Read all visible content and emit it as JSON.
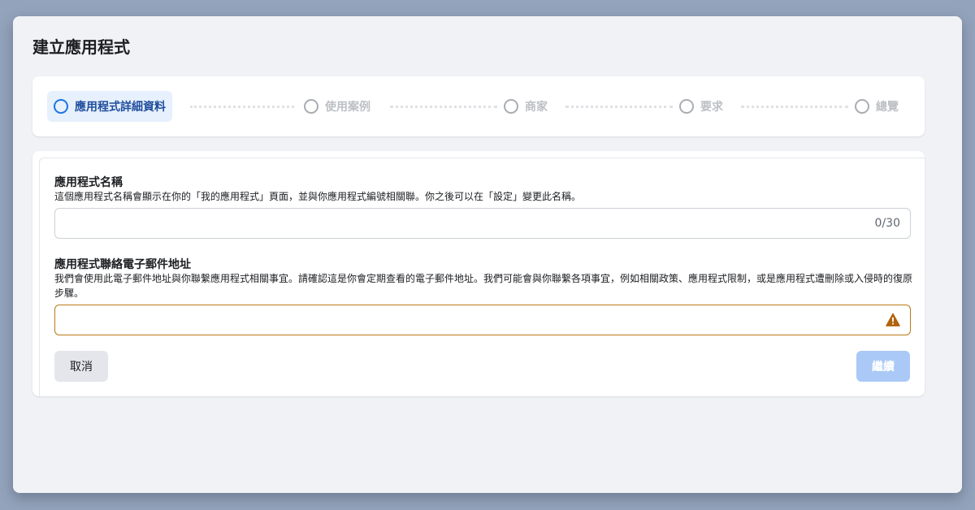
{
  "dialog": {
    "title": "建立應用程式"
  },
  "steps": [
    {
      "label": "應用程式詳細資料",
      "active": true
    },
    {
      "label": "使用案例",
      "active": false
    },
    {
      "label": "商家",
      "active": false
    },
    {
      "label": "要求",
      "active": false
    },
    {
      "label": "總覽",
      "active": false
    }
  ],
  "form": {
    "app_name": {
      "label": "應用程式名稱",
      "description": "這個應用程式名稱會顯示在你的「我的應用程式」頁面，並與你應用程式編號相關聯。你之後可以在「設定」變更此名稱。",
      "value": "",
      "counter": "0/30"
    },
    "contact_email": {
      "label": "應用程式聯絡電子郵件地址",
      "description": "我們會使用此電子郵件地址與你聯繫應用程式相關事宜。請確認這是你會定期查看的電子郵件地址。我們可能會與你聯繫各項事宜，例如相關政策、應用程式限制，或是應用程式遭刪除或入侵時的復原步驟。",
      "value": "",
      "status_icon": "warning-icon"
    }
  },
  "buttons": {
    "cancel": "取消",
    "continue": "繼續"
  },
  "colors": {
    "accent": "#1b74e4",
    "warning": "#b0640f",
    "active_step_bg": "#e7f0fd"
  }
}
